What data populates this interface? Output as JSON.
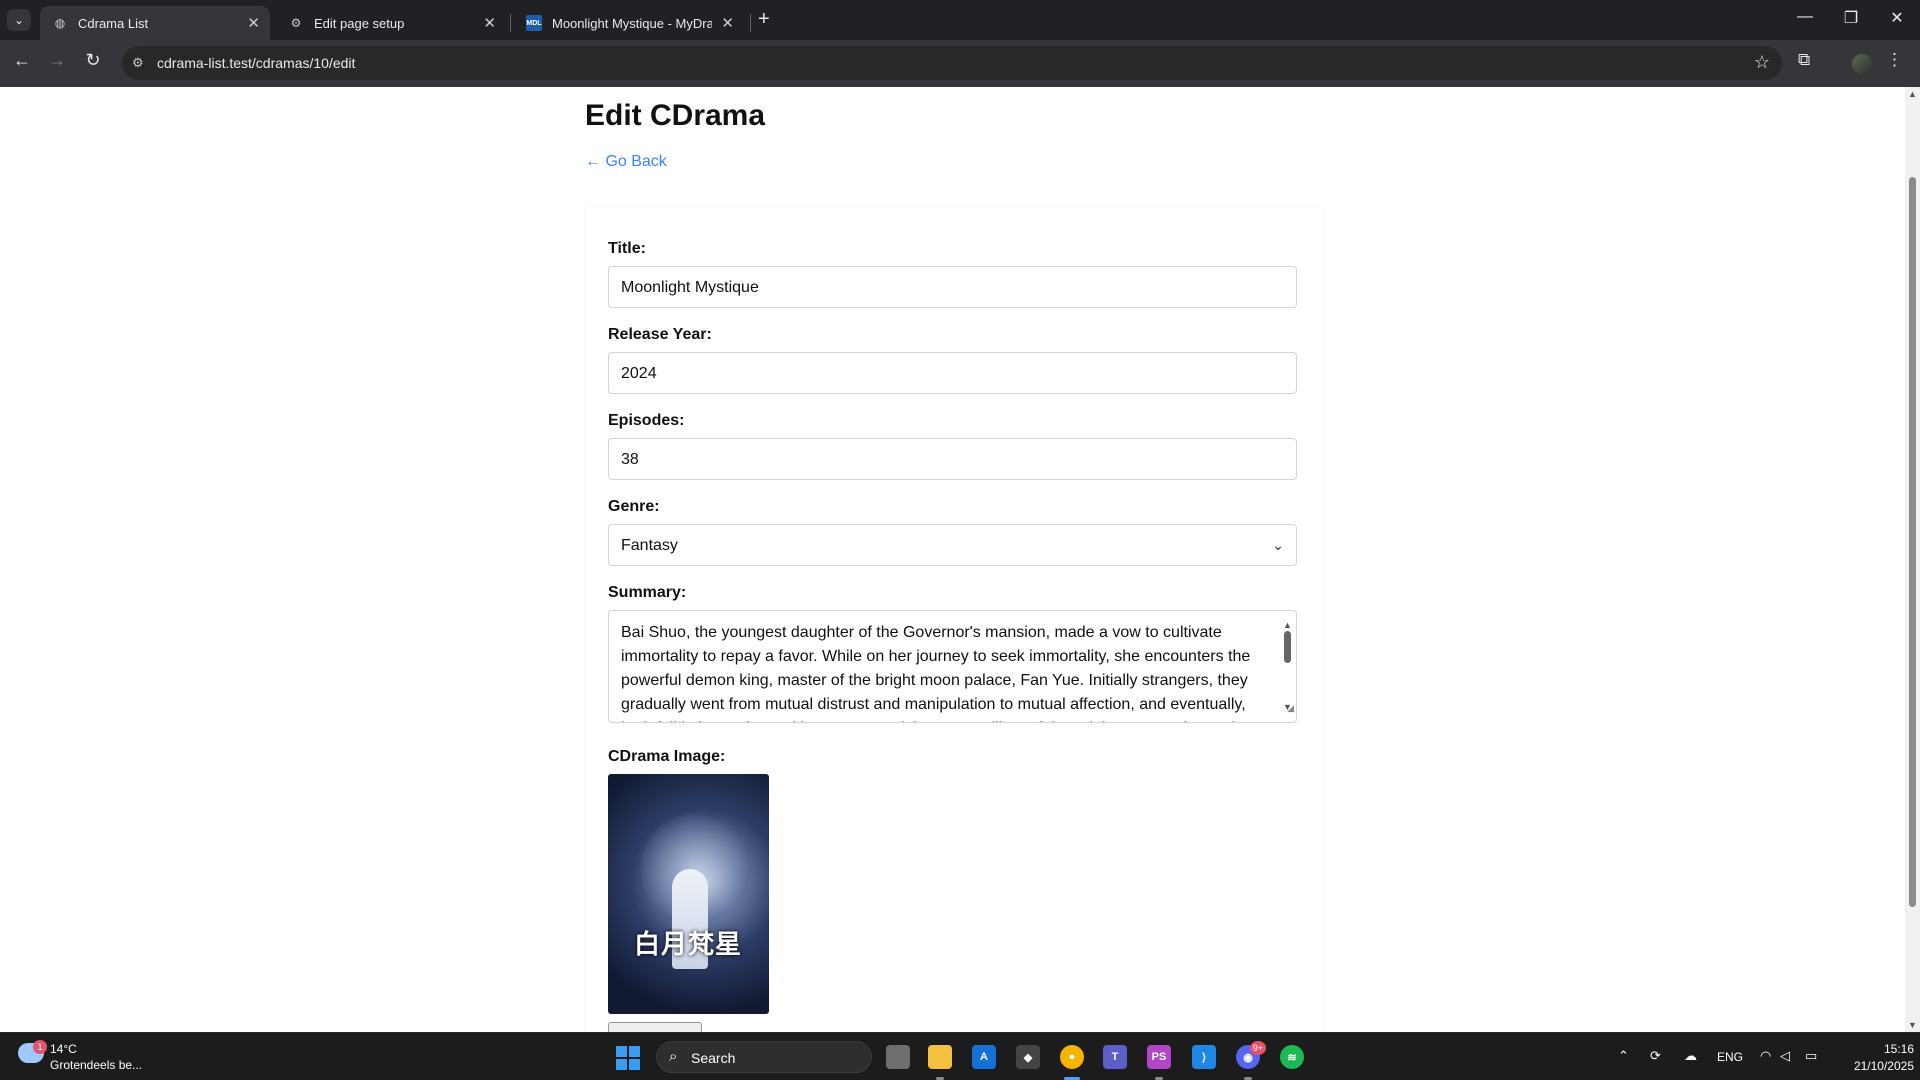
{
  "browser": {
    "tabs": [
      {
        "label": "Cdrama List",
        "active": true
      },
      {
        "label": "Edit page setup",
        "active": false
      },
      {
        "label": "Moonlight Mystique - MyDrama",
        "active": false
      }
    ],
    "url": "cdrama-list.test/cdramas/10/edit"
  },
  "page": {
    "title": "Edit CDrama",
    "go_back": "← Go Back"
  },
  "form": {
    "title_label": "Title:",
    "title_value": "Moonlight Mystique",
    "year_label": "Release Year:",
    "year_value": "2024",
    "episodes_label": "Episodes:",
    "episodes_value": "38",
    "genre_label": "Genre:",
    "genre_value": "Fantasy",
    "summary_label": "Summary:",
    "summary_value": "Bai Shuo, the youngest daughter of the Governor's mansion, made a vow to cultivate immortality to repay a favor. While on her journey to seek immortality, she encounters the powerful demon king, master of the bright moon palace, Fan Yue. Initially strangers, they gradually went from mutual distrust and manipulation to mutual affection, and eventually, both fall in love. Along with Fan Yue and the seven pillars of the Bright Moon Palace. The",
    "image_label": "CDrama Image:",
    "poster_logo": "白月梵星"
  },
  "taskbar": {
    "weather_temp": "14°C",
    "weather_desc": "Grotendeels be...",
    "weather_badge": "1",
    "search": "Search",
    "lang": "ENG",
    "time": "15:16",
    "date": "21/10/2025",
    "discord_badge": "9+"
  },
  "colors": {
    "link": "#3b82f6",
    "chrome_bg": "#202124",
    "active_tab": "#35363a"
  }
}
